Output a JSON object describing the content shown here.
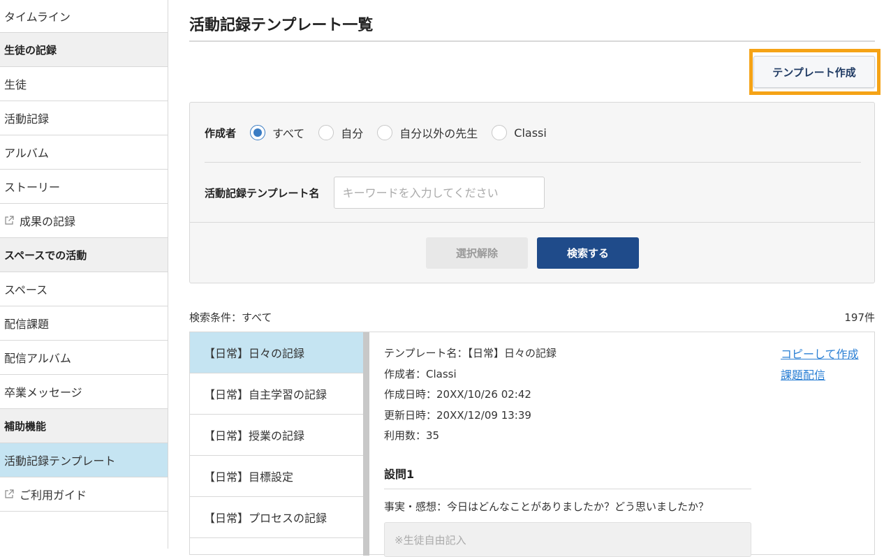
{
  "sidebar": {
    "items": [
      {
        "label": "タイムライン"
      },
      {
        "label": "生徒の記録"
      },
      {
        "label": "生徒"
      },
      {
        "label": "活動記録"
      },
      {
        "label": "アルバム"
      },
      {
        "label": "ストーリー"
      },
      {
        "label": "成果の記録"
      },
      {
        "label": "スペースでの活動"
      },
      {
        "label": "スペース"
      },
      {
        "label": "配信課題"
      },
      {
        "label": "配信アルバム"
      },
      {
        "label": "卒業メッセージ"
      },
      {
        "label": "補助機能"
      },
      {
        "label": "活動記録テンプレート"
      },
      {
        "label": "ご利用ガイド"
      }
    ]
  },
  "page": {
    "title": "活動記録テンプレート一覧",
    "create_button": "テンプレート作成"
  },
  "filter": {
    "author_label": "作成者",
    "author_options": [
      "すべて",
      "自分",
      "自分以外の先生",
      "Classi"
    ],
    "author_selected": "すべて",
    "name_label": "活動記録テンプレート名",
    "name_placeholder": "キーワードを入力してください",
    "clear_button": "選択解除",
    "search_button": "検索する"
  },
  "results": {
    "condition": "検索条件：すべて",
    "count": "197件",
    "templates": [
      "【日常】日々の記録",
      "【日常】自主学習の記録",
      "【日常】授業の記録",
      "【日常】目標設定",
      "【日常】プロセスの記録"
    ],
    "detail": {
      "name": "テンプレート名：【日常】日々の記録",
      "author": "作成者：Classi",
      "created": "作成日時：20XX/10/26 02:42",
      "updated": "更新日時：20XX/12/09 13:39",
      "usage": "利用数：35",
      "question_title": "設問1",
      "question_text": "事実・感想：今日はどんなことがありましたか？どう思いましたか？",
      "answer_placeholder": "※生徒自由記入",
      "copy_link": "コピーして作成",
      "assign_link": "課題配信"
    }
  },
  "colors": {
    "accent": "#1f4b8a",
    "highlight": "#f5a316",
    "selected_bg": "#c5e4f2",
    "link": "#2a7fd4"
  }
}
